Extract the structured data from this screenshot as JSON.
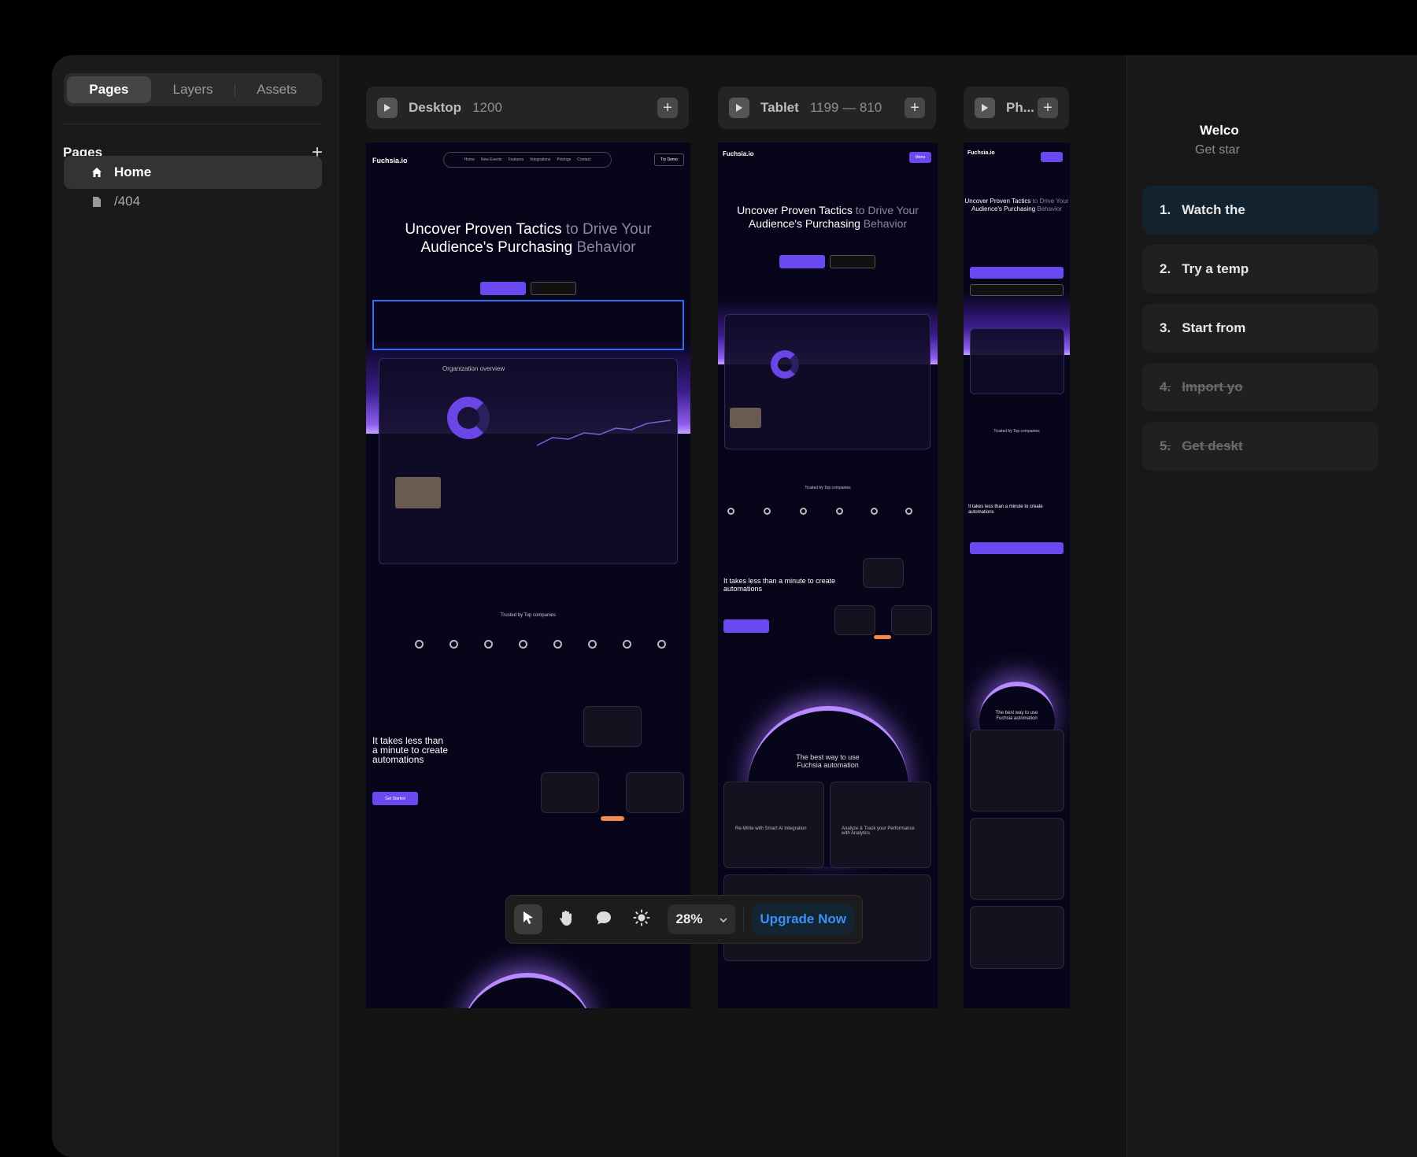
{
  "sidebar": {
    "tabs": [
      "Pages",
      "Layers",
      "Assets"
    ],
    "section_title": "Pages",
    "pages": [
      {
        "label": "Home",
        "icon": "home-icon",
        "active": true
      },
      {
        "label": "/404",
        "icon": "file-icon",
        "active": false
      }
    ]
  },
  "breakpoints": [
    {
      "name": "Desktop",
      "size": "1200"
    },
    {
      "name": "Tablet",
      "size": "1199 — 810"
    },
    {
      "name": "Ph...",
      "size": ""
    }
  ],
  "site_preview": {
    "logo": "Fuchsia.io",
    "nav": [
      "Home",
      "New Events",
      "Features",
      "Integrations",
      "Pricings",
      "Contact"
    ],
    "cta": "Try Demo",
    "menu_label": "Menu",
    "headline_bright": "Uncover Proven Tactics",
    "headline_dim_1": " to Drive Your",
    "headline_line2_bright": "Audience's Purchasing",
    "headline_line2_dim": " Behavior",
    "dashboard_title": "Organization overview",
    "trusted": "Trusted by Top companies",
    "minute_1": "It takes less than",
    "minute_2": "a minute to create",
    "minute_3": "automations",
    "get_started": "Get Started",
    "best_way_1": "The best way to use",
    "best_way_2": "Fuchsia automation",
    "feature_1": "Re-Write with Smart AI Integration",
    "feature_2": "Analyze & Track your Performance with Analytics"
  },
  "right_panel": {
    "welcome": "Welco",
    "subtitle": "Get star",
    "steps": [
      {
        "num": "1.",
        "label": "Watch the",
        "state": "current"
      },
      {
        "num": "2.",
        "label": "Try a temp",
        "state": "todo"
      },
      {
        "num": "3.",
        "label": "Start from",
        "state": "todo"
      },
      {
        "num": "4.",
        "label": "Import yo",
        "state": "done"
      },
      {
        "num": "5.",
        "label": "Get deskt",
        "state": "done"
      }
    ]
  },
  "toolbar": {
    "zoom": "28%",
    "upgrade": "Upgrade Now"
  },
  "colors": {
    "accent": "#6a4af0",
    "selection": "#2f6df6",
    "upgrade_text": "#3d8ff5"
  }
}
